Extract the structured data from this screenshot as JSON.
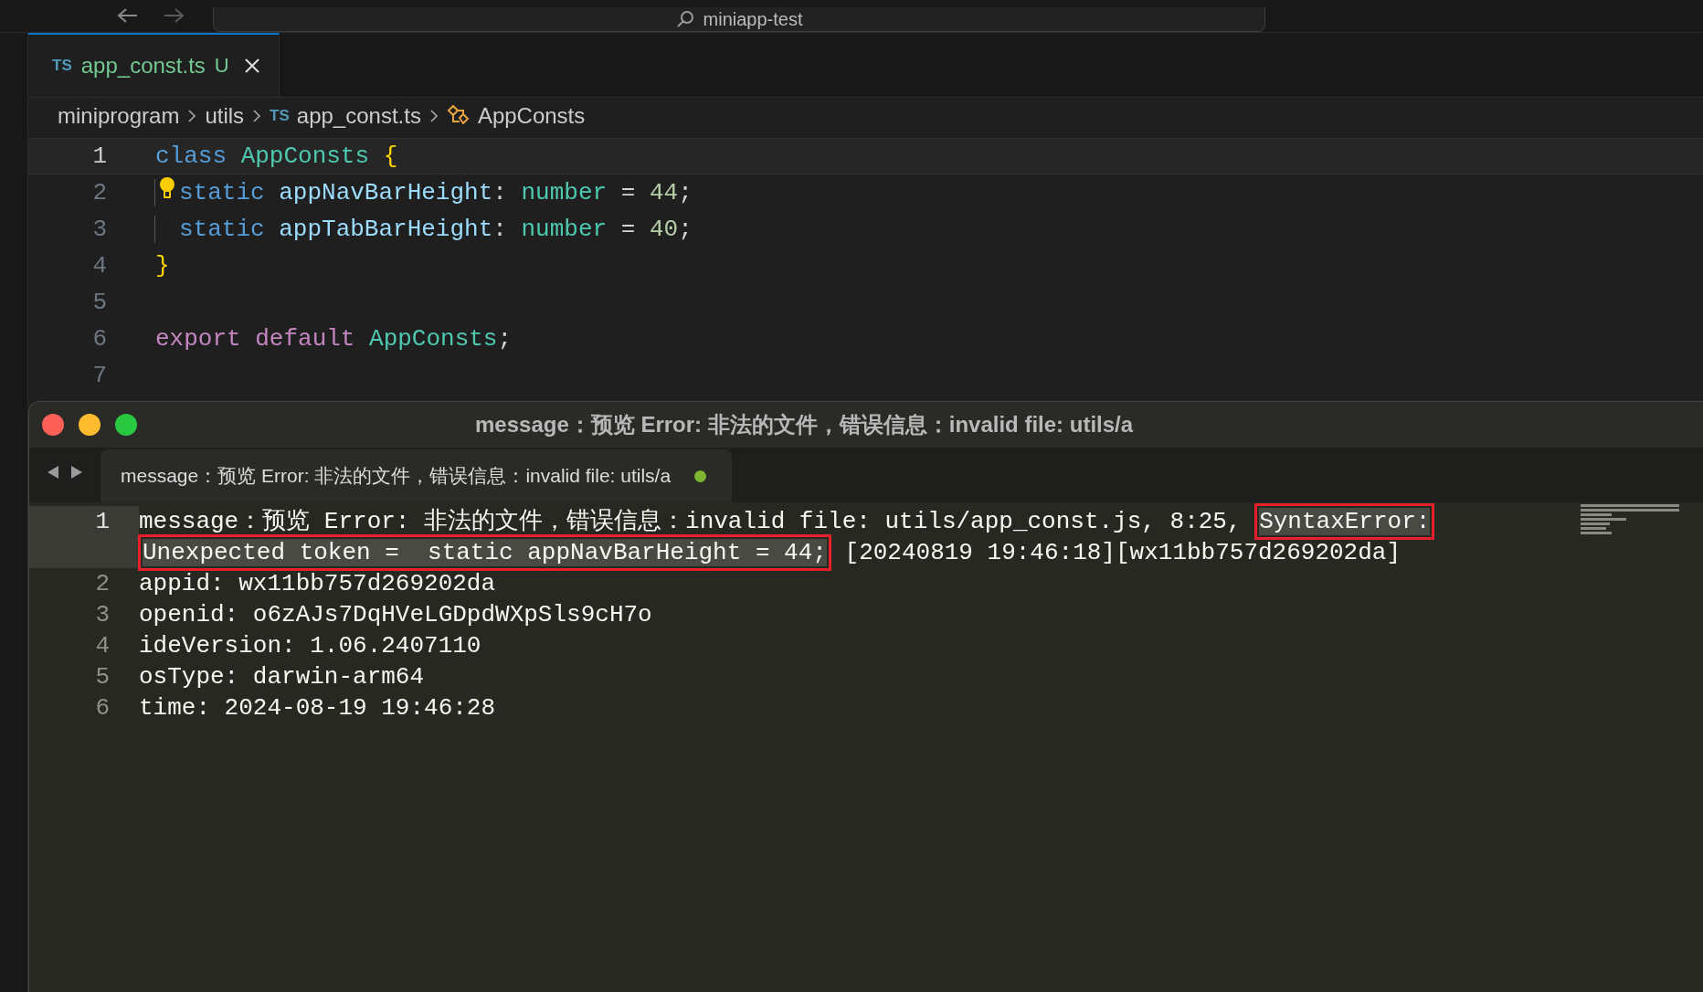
{
  "title_bar": {
    "search": "miniapp-test"
  },
  "editor_tabs": [
    {
      "language": "TS",
      "label": "app_const.ts",
      "status": "U",
      "selected": true
    }
  ],
  "breadcrumbs": [
    {
      "label": "miniprogram",
      "kind": "folder"
    },
    {
      "label": "utils",
      "kind": "folder"
    },
    {
      "label": "app_const.ts",
      "kind": "file",
      "badge": "TS"
    },
    {
      "label": "AppConsts",
      "kind": "class"
    }
  ],
  "code_lines": [
    {
      "number": "1",
      "current": true,
      "lightbulb": false,
      "indented": false,
      "tokens": [
        {
          "text": "class ",
          "kind": "keyword"
        },
        {
          "text": "AppConsts ",
          "kind": "type"
        },
        {
          "text": "{",
          "kind": "brace"
        }
      ]
    },
    {
      "number": "2",
      "current": false,
      "lightbulb": true,
      "indented": true,
      "tokens": [
        {
          "text": "static ",
          "kind": "keyword"
        },
        {
          "text": "appNavBarHeight",
          "kind": "prop"
        },
        {
          "text": ": ",
          "kind": "punct"
        },
        {
          "text": "number",
          "kind": "type"
        },
        {
          "text": " = ",
          "kind": "punct"
        },
        {
          "text": "44",
          "kind": "number"
        },
        {
          "text": ";",
          "kind": "punct"
        }
      ]
    },
    {
      "number": "3",
      "current": false,
      "lightbulb": false,
      "indented": true,
      "tokens": [
        {
          "text": "static ",
          "kind": "keyword"
        },
        {
          "text": "appTabBarHeight",
          "kind": "prop"
        },
        {
          "text": ": ",
          "kind": "punct"
        },
        {
          "text": "number",
          "kind": "type"
        },
        {
          "text": " = ",
          "kind": "punct"
        },
        {
          "text": "40",
          "kind": "number"
        },
        {
          "text": ";",
          "kind": "punct"
        }
      ]
    },
    {
      "number": "4",
      "current": false,
      "lightbulb": false,
      "indented": false,
      "tokens": [
        {
          "text": "}",
          "kind": "brace"
        }
      ]
    },
    {
      "number": "5",
      "current": false,
      "lightbulb": false,
      "indented": false
    },
    {
      "number": "6",
      "current": false,
      "lightbulb": false,
      "indented": false,
      "tokens": [
        {
          "text": "export default ",
          "kind": "export"
        },
        {
          "text": "AppConsts",
          "kind": "type"
        },
        {
          "text": ";",
          "kind": "punct"
        }
      ]
    },
    {
      "number": "7",
      "current": false,
      "lightbulb": false,
      "indented": false
    }
  ],
  "message_window": {
    "title": "message：预览 Error: 非法的文件，错误信息：invalid file: utils/a",
    "tabs": [
      {
        "label": "message：预览 Error: 非法的文件，错误信息：invalid file: utils/a",
        "modified": true,
        "selected": true
      }
    ],
    "lines": [
      {
        "number": "1",
        "current": true,
        "segments": [
          {
            "text": "message：预览 Error: 非法的文件，错误信息：invalid file: utils/app_const.js, 8:25, ",
            "selected": false,
            "boxed": false
          },
          {
            "text": "SyntaxError:",
            "selected": true,
            "boxed": true
          },
          {
            "text": "Unexpected token =  static appNavBarHeight = 44;",
            "selected": true,
            "boxed": true
          },
          {
            "text": " [20240819 19:46:18][wx11bb757d269202da]",
            "selected": false,
            "boxed": false
          }
        ]
      },
      {
        "number": "2",
        "current": false,
        "segments": [
          {
            "text": "appid: wx11bb757d269202da",
            "selected": false,
            "boxed": false
          }
        ]
      },
      {
        "number": "3",
        "current": false,
        "segments": [
          {
            "text": "openid: o6zAJs7DqHVeLGDpdWXpSls9cH7o",
            "selected": false,
            "boxed": false
          }
        ]
      },
      {
        "number": "4",
        "current": false,
        "segments": [
          {
            "text": "ideVersion: 1.06.2407110",
            "selected": false,
            "boxed": false
          }
        ]
      },
      {
        "number": "5",
        "current": false,
        "segments": [
          {
            "text": "osType: darwin-arm64",
            "selected": false,
            "boxed": false
          }
        ]
      },
      {
        "number": "6",
        "current": false,
        "segments": [
          {
            "text": "time: 2024-08-19 19:46:28",
            "selected": false,
            "boxed": false
          }
        ]
      }
    ]
  }
}
